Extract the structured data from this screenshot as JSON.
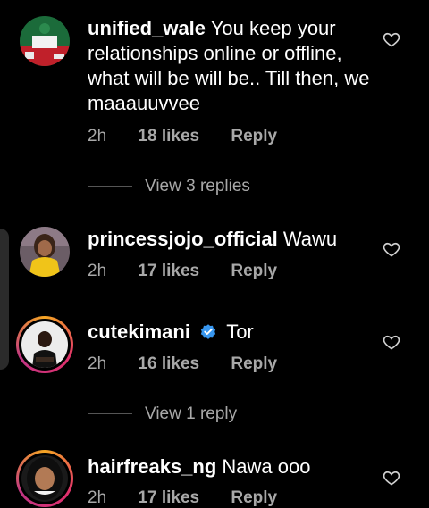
{
  "comments": [
    {
      "username": "unified_wale",
      "text": "You keep your relationships online or offline, what will be will be.. Till then, we maaauuvvee",
      "time": "2h",
      "likes": "18 likes",
      "reply": "Reply"
    },
    {
      "username": "princessjojo_official",
      "text": "Wawu",
      "time": "2h",
      "likes": "17 likes",
      "reply": "Reply"
    },
    {
      "username": "cutekimani",
      "text": "Tor",
      "time": "2h",
      "likes": "16 likes",
      "reply": "Reply"
    },
    {
      "username": "hairfreaks_ng",
      "text": "Nawa ooo",
      "time": "2h",
      "likes": "17 likes",
      "reply": "Reply"
    }
  ],
  "view_replies": [
    "View 3 replies",
    "View 1 reply"
  ],
  "icons": {
    "like": "heart-outline-icon",
    "verified": "verified-badge-icon"
  },
  "colors": {
    "background": "#000000",
    "meta_text": "#a8a8a8",
    "verified_blue": "#3897f0",
    "story_ring": "#e1306c"
  }
}
